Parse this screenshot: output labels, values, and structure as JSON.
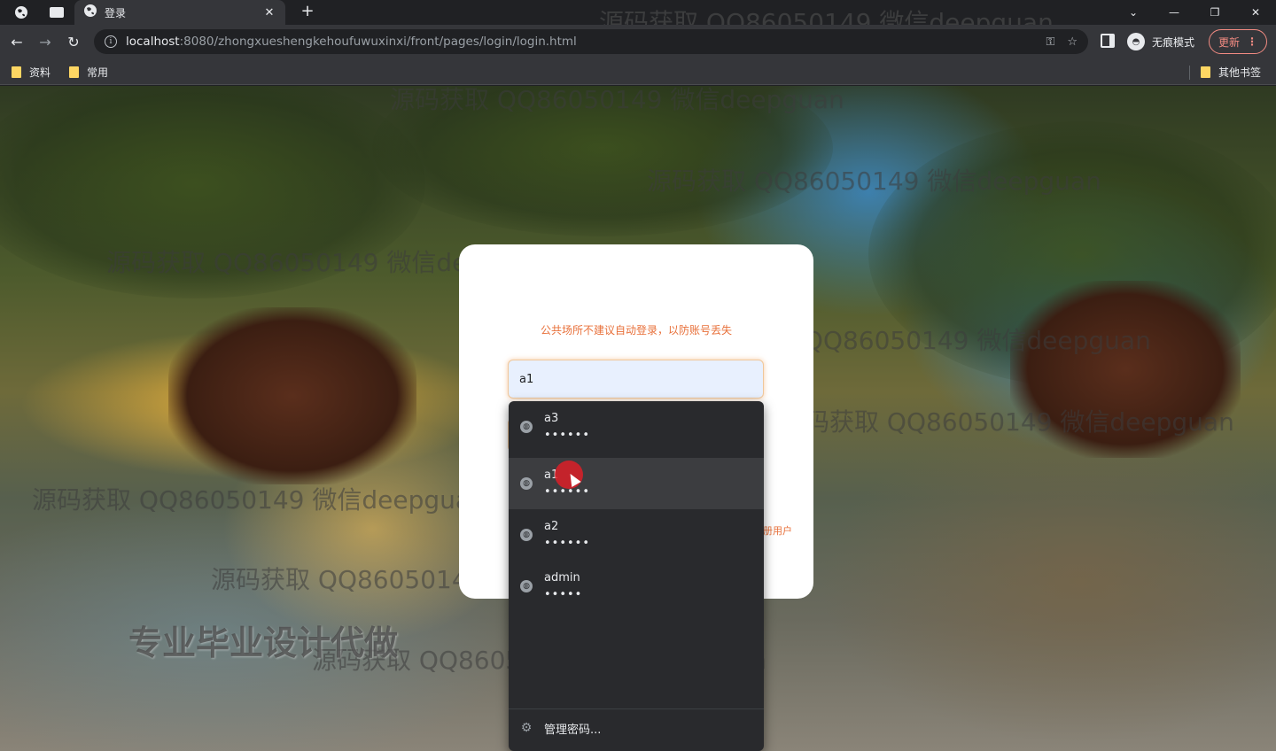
{
  "browser": {
    "tab_title": "登录",
    "url_host": "localhost",
    "url_path": ":8080/zhongxueshengkehoufuwuxinxi/front/pages/login/login.html",
    "incognito_label": "无痕模式",
    "update_label": "更新",
    "bookmarks": [
      "资料",
      "常用"
    ],
    "other_bookmarks": "其他书签"
  },
  "login": {
    "tip": "公共场所不建议自动登录，以防账号丢失",
    "username_value": "a1",
    "register_text": "册用户"
  },
  "autofill": {
    "entries": [
      {
        "user": "a3",
        "password": "••••••"
      },
      {
        "user": "a1",
        "password": "••••••"
      },
      {
        "user": "a2",
        "password": "••••••"
      },
      {
        "user": "admin",
        "password": "•••••"
      }
    ],
    "manage_label": "管理密码..."
  },
  "watermarks": {
    "text": "源码获取 QQ86050149 微信deepguan",
    "big": "专业毕业设计代做"
  },
  "icons": {
    "tab_favicon": "globe-icon",
    "entry_icon": "globe-icon",
    "manage_icon": "gear-icon"
  },
  "colors": {
    "accent": "#e8703a",
    "input_bg": "#e8f0fe",
    "autofill_bg": "#292a2d"
  }
}
